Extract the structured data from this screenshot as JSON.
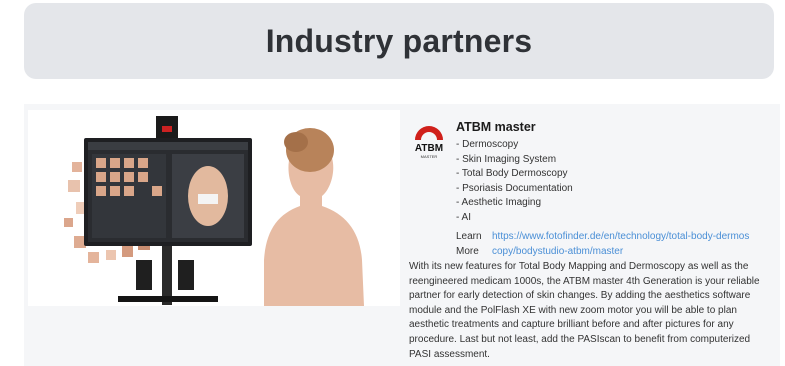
{
  "header": {
    "title": "Industry partners"
  },
  "partner": {
    "name": "ATBM master",
    "logo": {
      "text": "ATBM",
      "subtext": "MASTER",
      "color": "#d0201b"
    },
    "features": [
      "- Dermoscopy",
      "- Skin Imaging System",
      "- Total Body Dermoscopy",
      "- Psoriasis Documentation",
      "- Aesthetic Imaging",
      "- AI"
    ],
    "learn_more_label": "Learn More",
    "learn_more_url": "https://www.fotofinder.de/en/technology/total-body-dermoscopy/bodystudio-atbm/master",
    "description": "With its new features for Total Body Mapping and Dermoscopy as well as the reengineered medicam 1000s, the ATBM master 4th Generation is your reliable partner for early detection of skin changes. By adding the aesthetics software module and the PolFlash XE with new zoom motor you will be able to plan aesthetic treatments and capture brilliant before and after pictures for any procedure. Last but not least, add the PASIscan to benefit from computerized PASI assessment."
  },
  "colors": {
    "header_bg": "#e4e6ea",
    "card_bg": "#f5f6f8",
    "link": "#4a8fd6",
    "brand_red": "#d0201b"
  }
}
